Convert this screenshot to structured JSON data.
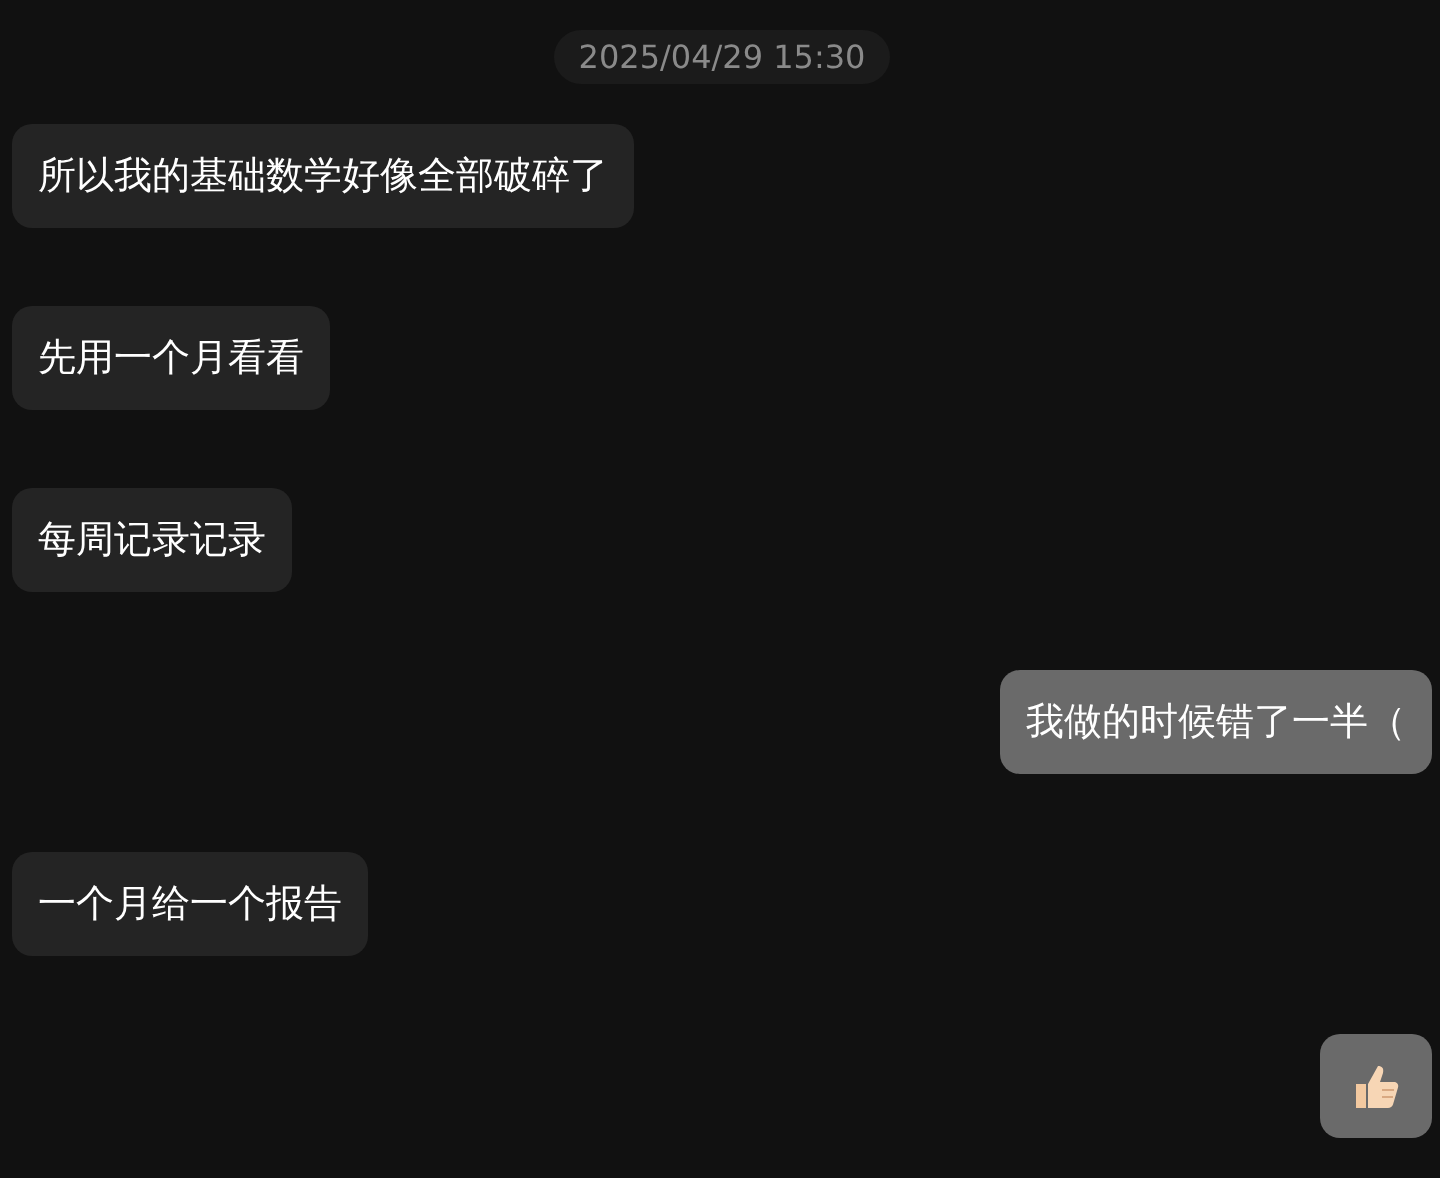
{
  "timestamp": "2025/04/29 15:30",
  "messages": [
    {
      "outgoing": false,
      "kind": "text",
      "text": "所以我的基础数学好像全部破碎了"
    },
    {
      "outgoing": false,
      "kind": "text",
      "text": "先用一个月看看"
    },
    {
      "outgoing": false,
      "kind": "text",
      "text": "每周记录记录"
    },
    {
      "outgoing": true,
      "kind": "text",
      "text": "我做的时候错了一半（"
    },
    {
      "outgoing": false,
      "kind": "text",
      "text": "一个月给一个报告"
    },
    {
      "outgoing": true,
      "kind": "thumbs_up"
    }
  ]
}
